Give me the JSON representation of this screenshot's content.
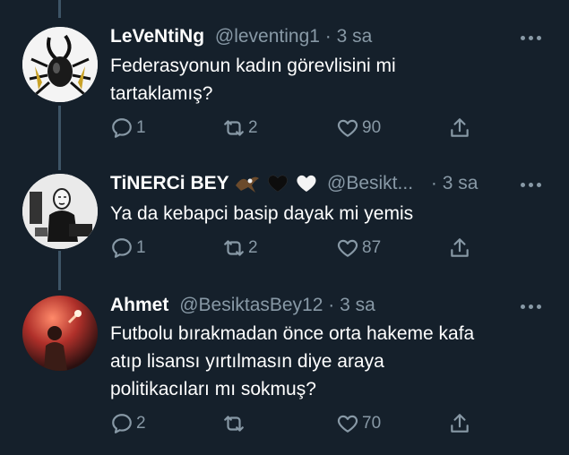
{
  "tweets": [
    {
      "name": "LeVeNtiNg",
      "name_emoji": [],
      "handle": "@leventing1",
      "sep": "·",
      "time": "3 sa",
      "text_lines": [
        "Federasyonun kadın görevlisini mi",
        "tartaklamış?"
      ],
      "replies": "1",
      "retweets": "2",
      "likes": "90",
      "avatar_icon": "beetle-avatar"
    },
    {
      "name": "TiNERCi BEY",
      "name_emoji": [
        "eagle-emoji",
        "black-heart-emoji",
        "white-heart-emoji"
      ],
      "handle": "@Besikt...",
      "sep": "·",
      "time": "3 sa",
      "text_lines": [
        "Ya da kebapci basip dayak mi yemis"
      ],
      "replies": "1",
      "retweets": "2",
      "likes": "87",
      "avatar_icon": "masked-man-avatar"
    },
    {
      "name": "Ahmet",
      "name_emoji": [],
      "handle": "@BesiktasBey12",
      "sep": "·",
      "time": "3 sa",
      "text_lines": [
        "Futbolu bırakmadan önce orta hakeme kafa",
        "atıp lisansı yırtılmasın diye araya",
        "politikacıları mı sokmuş?"
      ],
      "replies": "2",
      "retweets": "",
      "likes": "70",
      "avatar_icon": "flare-crowd-avatar"
    }
  ],
  "colors": {
    "background": "#15202b",
    "secondary_text": "#8899a6",
    "thread_line": "#3d5466"
  }
}
